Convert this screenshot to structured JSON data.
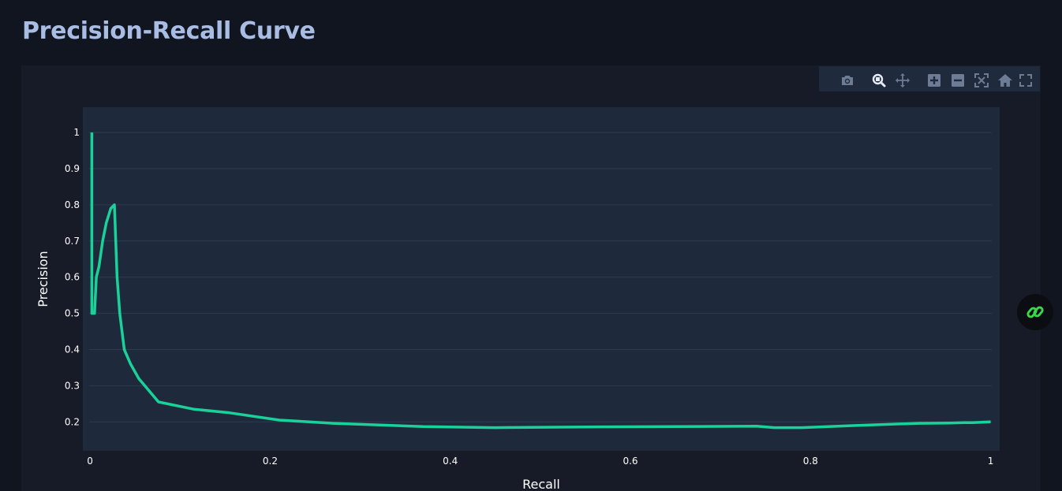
{
  "page": {
    "title": "Precision-Recall Curve"
  },
  "modebar": {
    "buttons": [
      {
        "icon": "camera-icon",
        "tooltip": "Download plot as a png"
      },
      {
        "icon": "zoom-icon",
        "tooltip": "Zoom"
      },
      {
        "icon": "pan-icon",
        "tooltip": "Pan"
      },
      {
        "icon": "zoom-in-icon",
        "tooltip": "Zoom in"
      },
      {
        "icon": "zoom-out-icon",
        "tooltip": "Zoom out"
      },
      {
        "icon": "autoscale-icon",
        "tooltip": "Autoscale"
      },
      {
        "icon": "reset-axes-icon",
        "tooltip": "Reset axes"
      },
      {
        "icon": "fullscreen-icon",
        "tooltip": "Fullscreen"
      }
    ]
  },
  "colors": {
    "page_bg": "#111520",
    "card_bg": "#161b27",
    "plot_bg": "#1f293c",
    "grid": "#2d3a52",
    "line": "#19d29a",
    "text": "#ffffff",
    "title": "#a9bde4"
  },
  "chart_data": {
    "type": "line",
    "title": "",
    "xlabel": "Recall",
    "ylabel": "Precision",
    "xlim": [
      -0.008,
      1.01
    ],
    "ylim": [
      0.12,
      1.07
    ],
    "xticks": [
      0,
      0.2,
      0.4,
      0.6,
      0.8,
      1
    ],
    "xtick_labels": [
      "0",
      "0.2",
      "0.4",
      "0.6",
      "0.8",
      "1"
    ],
    "yticks": [
      0.2,
      0.3,
      0.4,
      0.5,
      0.6,
      0.7,
      0.8,
      0.9,
      1
    ],
    "ytick_labels": [
      "0.2",
      "0.3",
      "0.4",
      "0.5",
      "0.6",
      "0.7",
      "0.8",
      "0.9",
      "1"
    ],
    "grid": true,
    "series": [
      {
        "x": [
          0.002,
          0.002,
          0.005,
          0.007,
          0.009,
          0.01,
          0.014,
          0.018,
          0.023,
          0.027,
          0.03,
          0.033,
          0.038,
          0.045,
          0.054,
          0.076,
          0.115,
          0.155,
          0.21,
          0.27,
          0.37,
          0.45,
          0.55,
          0.65,
          0.74,
          0.76,
          0.79,
          0.85,
          0.92,
          0.955,
          0.97,
          0.98,
          0.99,
          1.0
        ],
        "y": [
          1.0,
          0.5,
          0.5,
          0.6,
          0.62,
          0.63,
          0.7,
          0.75,
          0.79,
          0.8,
          0.6,
          0.5,
          0.4,
          0.36,
          0.32,
          0.255,
          0.235,
          0.225,
          0.205,
          0.196,
          0.187,
          0.184,
          0.186,
          0.187,
          0.188,
          0.184,
          0.184,
          0.19,
          0.196,
          0.197,
          0.198,
          0.198,
          0.199,
          0.2
        ]
      }
    ]
  }
}
